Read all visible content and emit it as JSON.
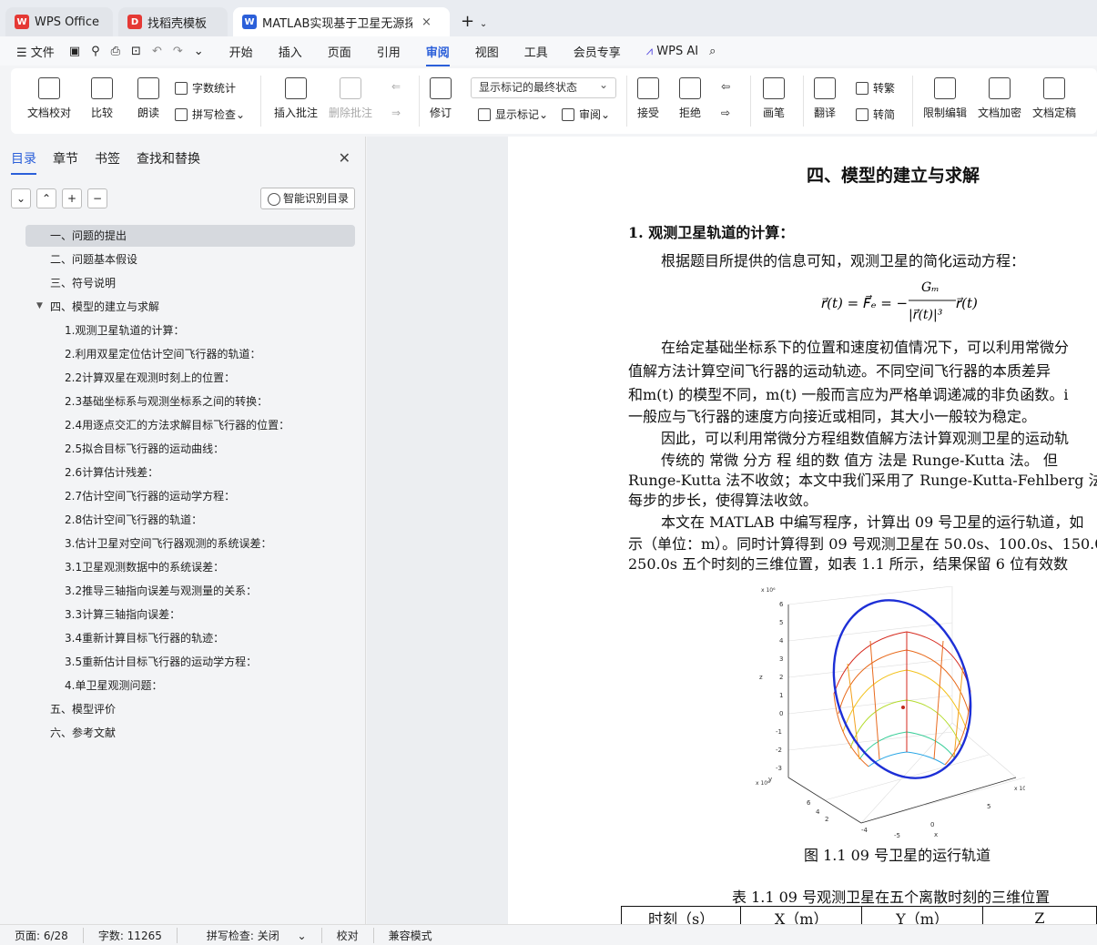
{
  "tabs": [
    {
      "label": "WPS Office",
      "icon": "wps-logo-icon"
    },
    {
      "label": "找稻壳模板",
      "icon": "docer-icon"
    },
    {
      "label": "MATLAB实现基于卫星无源探",
      "icon": "word-doc-icon"
    }
  ],
  "menu": {
    "file": "文件",
    "items": [
      "开始",
      "插入",
      "页面",
      "引用",
      "审阅",
      "视图",
      "工具",
      "会员专享"
    ],
    "active": "审阅",
    "ai": "WPS AI"
  },
  "ribbon": {
    "doc_check": "文档校对",
    "compare": "比较",
    "read": "朗读",
    "word_count": "字数统计",
    "spell_check": "拼写检查",
    "insert_comment": "插入批注",
    "delete_comment": "删除批注",
    "revise": "修订",
    "show_markup": "显示标记",
    "review": "审阅",
    "markup_state": "显示标记的最终状态",
    "accept": "接受",
    "reject": "拒绝",
    "pen": "画笔",
    "translate": "翻译",
    "to_traditional": "转繁",
    "to_simplified": "转简",
    "restrict_edit": "限制编辑",
    "encrypt": "文档加密",
    "finalize": "文档定稿"
  },
  "panel": {
    "tabs": [
      "目录",
      "章节",
      "书签",
      "查找和替换"
    ],
    "smart_toc": "智能识别目录",
    "toc": [
      {
        "label": "一、问题的提出",
        "level": 1,
        "selected": true
      },
      {
        "label": "二、问题基本假设",
        "level": 1
      },
      {
        "label": "三、符号说明",
        "level": 1
      },
      {
        "label": "四、模型的建立与求解",
        "level": 1,
        "expanded": true
      },
      {
        "label": "1.观测卫星轨道的计算：",
        "level": 2
      },
      {
        "label": "2.利用双星定位估计空间飞行器的轨道：",
        "level": 2
      },
      {
        "label": "2.2计算双星在观测时刻上的位置：",
        "level": 2
      },
      {
        "label": "2.3基础坐标系与观测坐标系之间的转换：",
        "level": 2
      },
      {
        "label": "2.4用逐点交汇的方法求解目标飞行器的位置：",
        "level": 2
      },
      {
        "label": "2.5拟合目标飞行器的运动曲线：",
        "level": 2
      },
      {
        "label": "2.6计算估计残差：",
        "level": 2
      },
      {
        "label": "2.7估计空间飞行器的运动学方程：",
        "level": 2
      },
      {
        "label": "2.8估计空间飞行器的轨道：",
        "level": 2
      },
      {
        "label": "3.估计卫星对空间飞行器观测的系统误差：",
        "level": 2
      },
      {
        "label": "3.1卫星观测数据中的系统误差：",
        "level": 2
      },
      {
        "label": "3.2推导三轴指向误差与观测量的关系：",
        "level": 2
      },
      {
        "label": "3.3计算三轴指向误差：",
        "level": 2
      },
      {
        "label": "3.4重新计算目标飞行器的轨迹：",
        "level": 2
      },
      {
        "label": "3.5重新估计目标飞行器的运动学方程：",
        "level": 2
      },
      {
        "label": "4.单卫星观测问题：",
        "level": 2
      },
      {
        "label": "五、模型评价",
        "level": 1
      },
      {
        "label": "六、参考文献",
        "level": 1
      }
    ]
  },
  "doc": {
    "heading": "四、模型的建立与求解",
    "sub": "1.  观测卫星轨道的计算：",
    "lines": [
      "根据题目所提供的信息可知，观测卫星的简化运动方程：",
      "在给定基础坐标系下的位置和速度初值情况下，可以利用常微分",
      "值解方法计算空间飞行器的运动轨迹。不同空间飞行器的本质差异",
      "和m(t) 的模型不同，m(t) 一般而言应为严格单调递减的非负函数。i",
      "一般应与飞行器的速度方向接近或相同，其大小一般较为稳定。",
      "因此，可以利用常微分方程组数值解方法计算观测卫星的运动轨",
      "传统的 常微 分方 程 组的数 值方 法是 Runge-Kutta 法。 但",
      "Runge-Kutta 法不收敛；本文中我们采用了 Runge-Kutta-Fehlberg 法,",
      "每步的步长，使得算法收敛。",
      "本文在 MATLAB 中编写程序，计算出 09 号卫星的运行轨道，如",
      "示（单位：m）。同时计算得到 09 号观测卫星在 50.0s、100.0s、150.0",
      "250.0s 五个时刻的三维位置，如表 1.1 所示，结果保留 6 位有效数"
    ],
    "equation": "r̈(t) = F⃗ₑ = − Gₘ / |r⃗(t)|³ · r⃗(t)",
    "fig_caption": "图 1.1 09 号卫星的运行轨道",
    "table_caption": "表 1.1 09 号观测卫星在五个离散时刻的三维位置",
    "table_head": [
      "时刻（s）",
      "X（m）",
      "Y（m）",
      "Z"
    ]
  },
  "status": {
    "page": "页面: 6/28",
    "words": "字数: 11265",
    "spell": "拼写检查: 关闭",
    "proof": "校对",
    "compat": "兼容模式"
  }
}
